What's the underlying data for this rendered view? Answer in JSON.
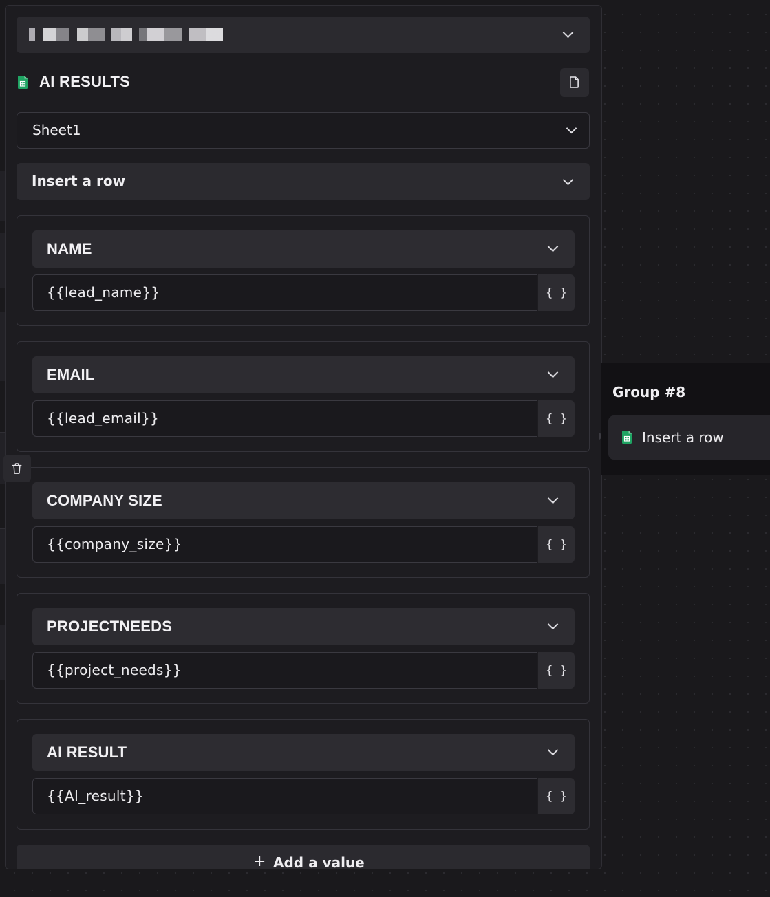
{
  "panel": {
    "account_select": {
      "value": ""
    },
    "sheet_header": {
      "title": "AI RESULTS",
      "icon": "google-sheets-icon"
    },
    "sheet_select": {
      "value": "Sheet1"
    },
    "action_select": {
      "value": "Insert a row"
    },
    "fields": [
      {
        "column": "NAME",
        "value": "{{lead_name}}",
        "var_button": "{ }"
      },
      {
        "column": "EMAIL",
        "value": "{{lead_email}}",
        "var_button": "{ }"
      },
      {
        "column": "COMPANY SIZE",
        "value": "{{company_size}}",
        "var_button": "{ }"
      },
      {
        "column": "PROJECTNEEDS",
        "value": "{{project_needs}}",
        "var_button": "{ }"
      },
      {
        "column": "AI RESULT",
        "value": "{{AI_result}}",
        "var_button": "{ }"
      }
    ],
    "add_value": {
      "label": "Add a value",
      "icon": "plus-icon"
    }
  },
  "canvas": {
    "group_node": {
      "title": "Group #8",
      "step": {
        "label": "Insert a row",
        "icon": "google-sheets-icon"
      }
    }
  },
  "colors": {
    "background": "#1a191c",
    "panel": "#1d1c20",
    "control": "#2b2a2f",
    "sheets_green": "#1fa463",
    "text": "#ecebee"
  }
}
